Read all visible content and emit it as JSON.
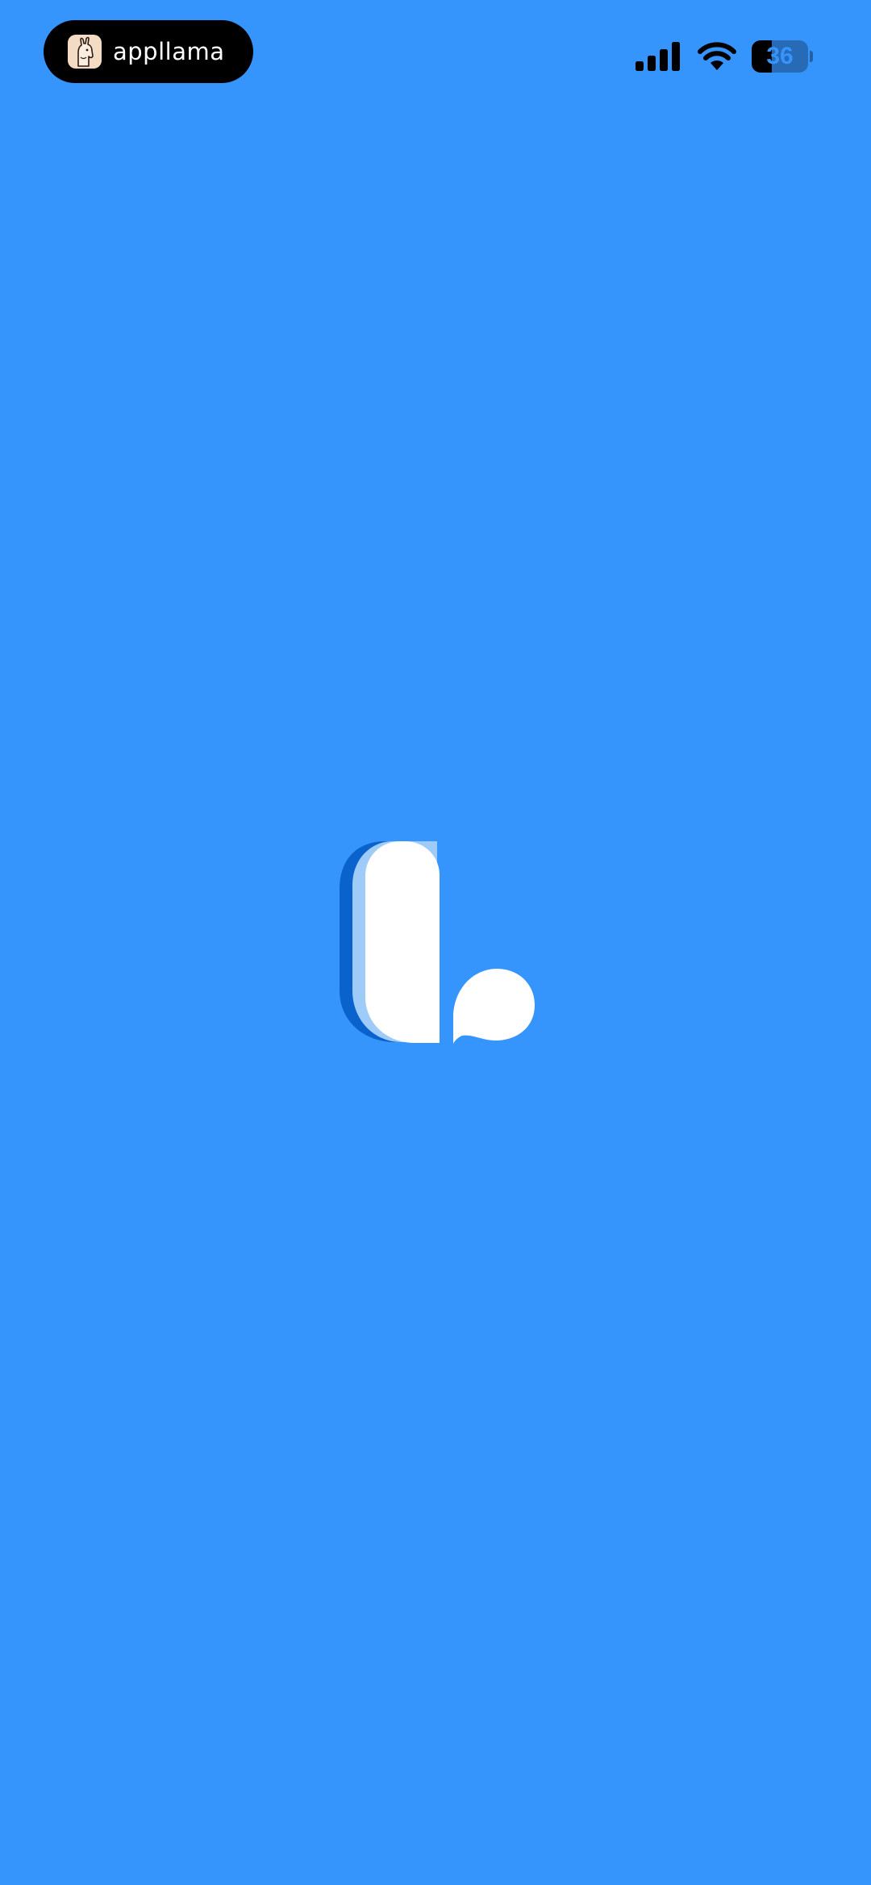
{
  "app": {
    "brand_name": "appllama",
    "brand_icon": "llama-icon",
    "background_color": "#3694fd",
    "splash_logo": "app-logo-icon"
  },
  "status_bar": {
    "signal_icon": "cellular-signal-icon",
    "wifi_icon": "wifi-icon",
    "battery_percent": "36",
    "battery_level": 0.36
  }
}
